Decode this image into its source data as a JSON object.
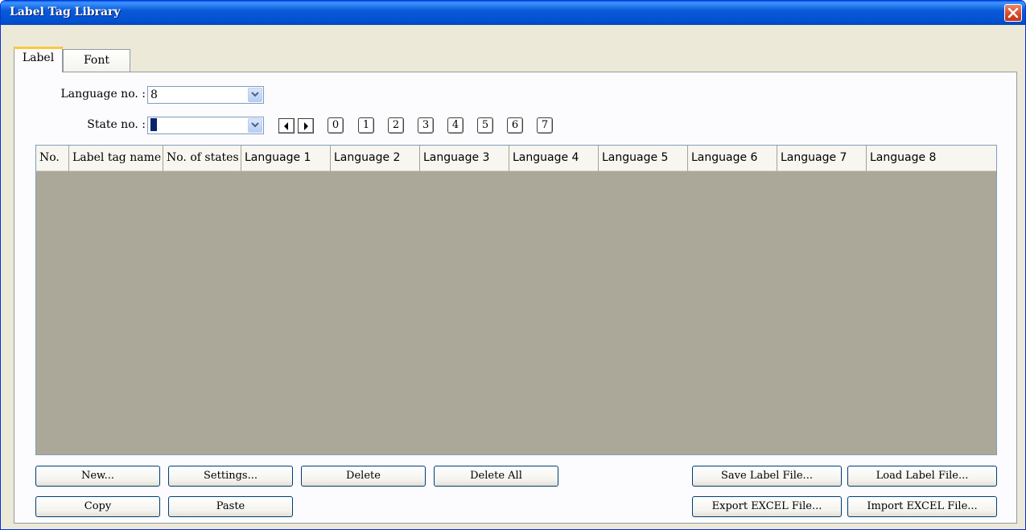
{
  "window": {
    "title": "Label Tag Library"
  },
  "tabs": [
    {
      "label": "Label"
    },
    {
      "label": "Font"
    }
  ],
  "language": {
    "label": "Language no. :",
    "value": "8"
  },
  "state": {
    "label": "State no. :",
    "value": "0",
    "buttons": [
      "0",
      "1",
      "2",
      "3",
      "4",
      "5",
      "6",
      "7"
    ]
  },
  "grid": {
    "columns": [
      "No.",
      "Label tag name",
      "No. of states",
      "Language 1",
      "Language 2",
      "Language 3",
      "Language 4",
      "Language 5",
      "Language 6",
      "Language 7",
      "Language 8"
    ],
    "rows": []
  },
  "buttons": {
    "new": "New...",
    "settings": "Settings...",
    "delete": "Delete",
    "delete_all": "Delete All",
    "copy": "Copy",
    "paste": "Paste",
    "save_label_file": "Save Label File...",
    "load_label_file": "Load Label File...",
    "export_excel": "Export EXCEL File...",
    "import_excel": "Import EXCEL File..."
  },
  "colors": {
    "titlebar": "#0a5ad8",
    "accent_tab": "#ffc83c",
    "grid_bg": "#aca899",
    "window_bg": "#ece9d8"
  }
}
